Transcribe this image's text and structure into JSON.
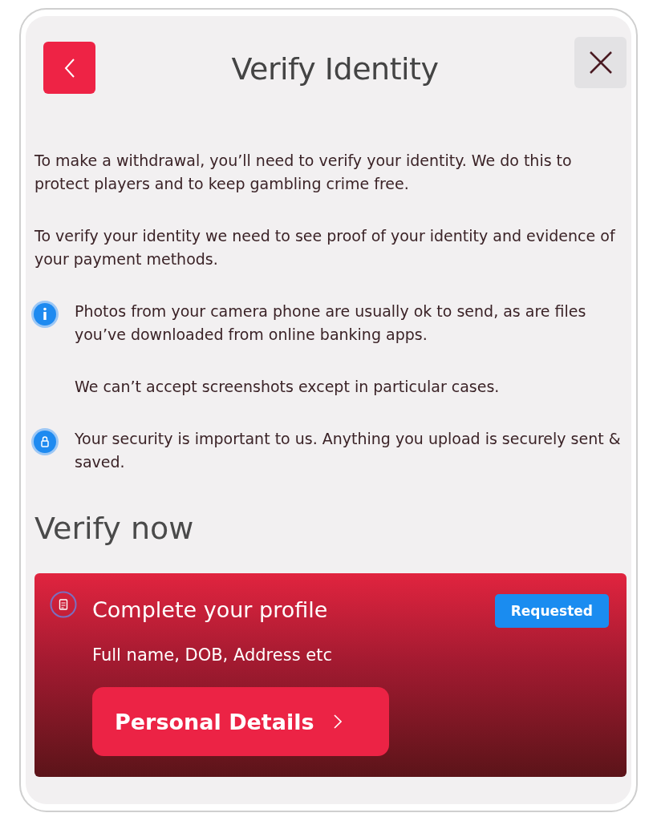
{
  "header": {
    "title": "Verify Identity"
  },
  "paragraphs": [
    "To make a withdrawal, you’ll need to verify your identity. We do this to protect players and to keep gambling crime free.",
    "To verify your identity we need to see proof of your identity and evidence of your payment methods."
  ],
  "notes": [
    {
      "kind": "info",
      "paragraphs": [
        "Photos from your camera phone are usually ok to send, as are files you’ve downloaded from online banking apps.",
        "We can’t accept screenshots except in particular cases."
      ]
    },
    {
      "kind": "lock",
      "paragraphs": [
        "Your security is important to us. Anything you upload is securely sent & saved."
      ]
    }
  ],
  "section_title": "Verify now",
  "card": {
    "title": "Complete your profile",
    "badge": "Requested",
    "subtitle": "Full name, DOB, Address etc",
    "button": "Personal Details"
  }
}
